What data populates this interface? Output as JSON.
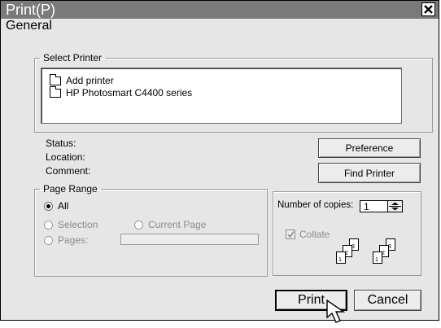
{
  "window": {
    "title": "Print(P)"
  },
  "section": {
    "title": "General"
  },
  "select_printer": {
    "legend": "Select Printer",
    "items": [
      {
        "label": "Add printer"
      },
      {
        "label": "HP Photosmart C4400 series"
      }
    ]
  },
  "info": {
    "status_label": "Status:",
    "location_label": "Location:",
    "comment_label": "Comment:"
  },
  "buttons": {
    "preference": "Preference",
    "find_printer": "Find Printer",
    "print": "Print",
    "cancel": "Cancel"
  },
  "page_range": {
    "legend": "Page Range",
    "all": "All",
    "selection": "Selection",
    "current_page": "Current Page",
    "pages": "Pages:",
    "selected": "All"
  },
  "copies": {
    "label": "Number of copies:",
    "value": "1",
    "collate_label": "Collate",
    "collate_checked": true
  },
  "colors": {
    "titlebar": "#7a7a7a",
    "dialog_bg": "#e6e6e6",
    "disabled_text": "#8c8c8c"
  }
}
